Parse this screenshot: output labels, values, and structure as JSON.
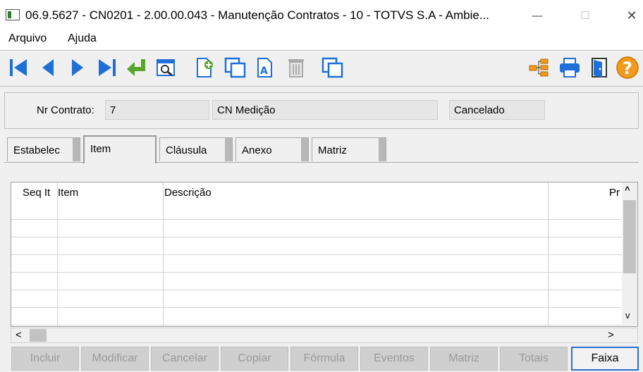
{
  "window": {
    "title": "06.9.5627 - CN0201 - 2.00.00.043 - Manutenção Contratos - 10 - TOTVS S.A - Ambie...",
    "controls": {
      "minimize": "—",
      "maximize": "☐",
      "close": "✕"
    }
  },
  "menu": {
    "file": "Arquivo",
    "help": "Ajuda"
  },
  "toolbar": {
    "icons": [
      "first-icon",
      "previous-icon",
      "next-icon",
      "last-icon",
      "goto-icon",
      "search-icon",
      "add-icon",
      "copy-icon",
      "edit-icon",
      "delete-icon",
      "copy2-icon",
      "tree-icon",
      "print-icon",
      "exit-icon",
      "help-icon"
    ],
    "colors": {
      "blue": "#1f6fd8",
      "green": "#57a52b",
      "orange": "#f29a1c"
    }
  },
  "header": {
    "contract_label": "Nr Contrato:",
    "contract_number": "7",
    "contract_type": "CN Medição",
    "status": "Cancelado"
  },
  "tabs": [
    {
      "label": "Estabelec",
      "active": false
    },
    {
      "label": "Item",
      "active": true
    },
    {
      "label": "Cláusula",
      "active": false
    },
    {
      "label": "Anexo",
      "active": false
    },
    {
      "label": "Matriz",
      "active": false
    }
  ],
  "grid": {
    "columns": [
      "Seq It",
      "Item",
      "Descrição",
      "Pr"
    ],
    "rows": []
  },
  "scroll": {
    "up": "^",
    "down": "v",
    "left": "<",
    "right": ">"
  },
  "buttons": [
    {
      "label": "Incluir",
      "enabled": false
    },
    {
      "label": "Modificar",
      "enabled": false
    },
    {
      "label": "Cancelar",
      "enabled": false
    },
    {
      "label": "Copiar",
      "enabled": false
    },
    {
      "label": "Fórmula",
      "enabled": false
    },
    {
      "label": "Eventos",
      "enabled": false
    },
    {
      "label": "Matriz",
      "enabled": false
    },
    {
      "label": "Totais",
      "enabled": false
    },
    {
      "label": "Faixa",
      "enabled": true
    }
  ]
}
